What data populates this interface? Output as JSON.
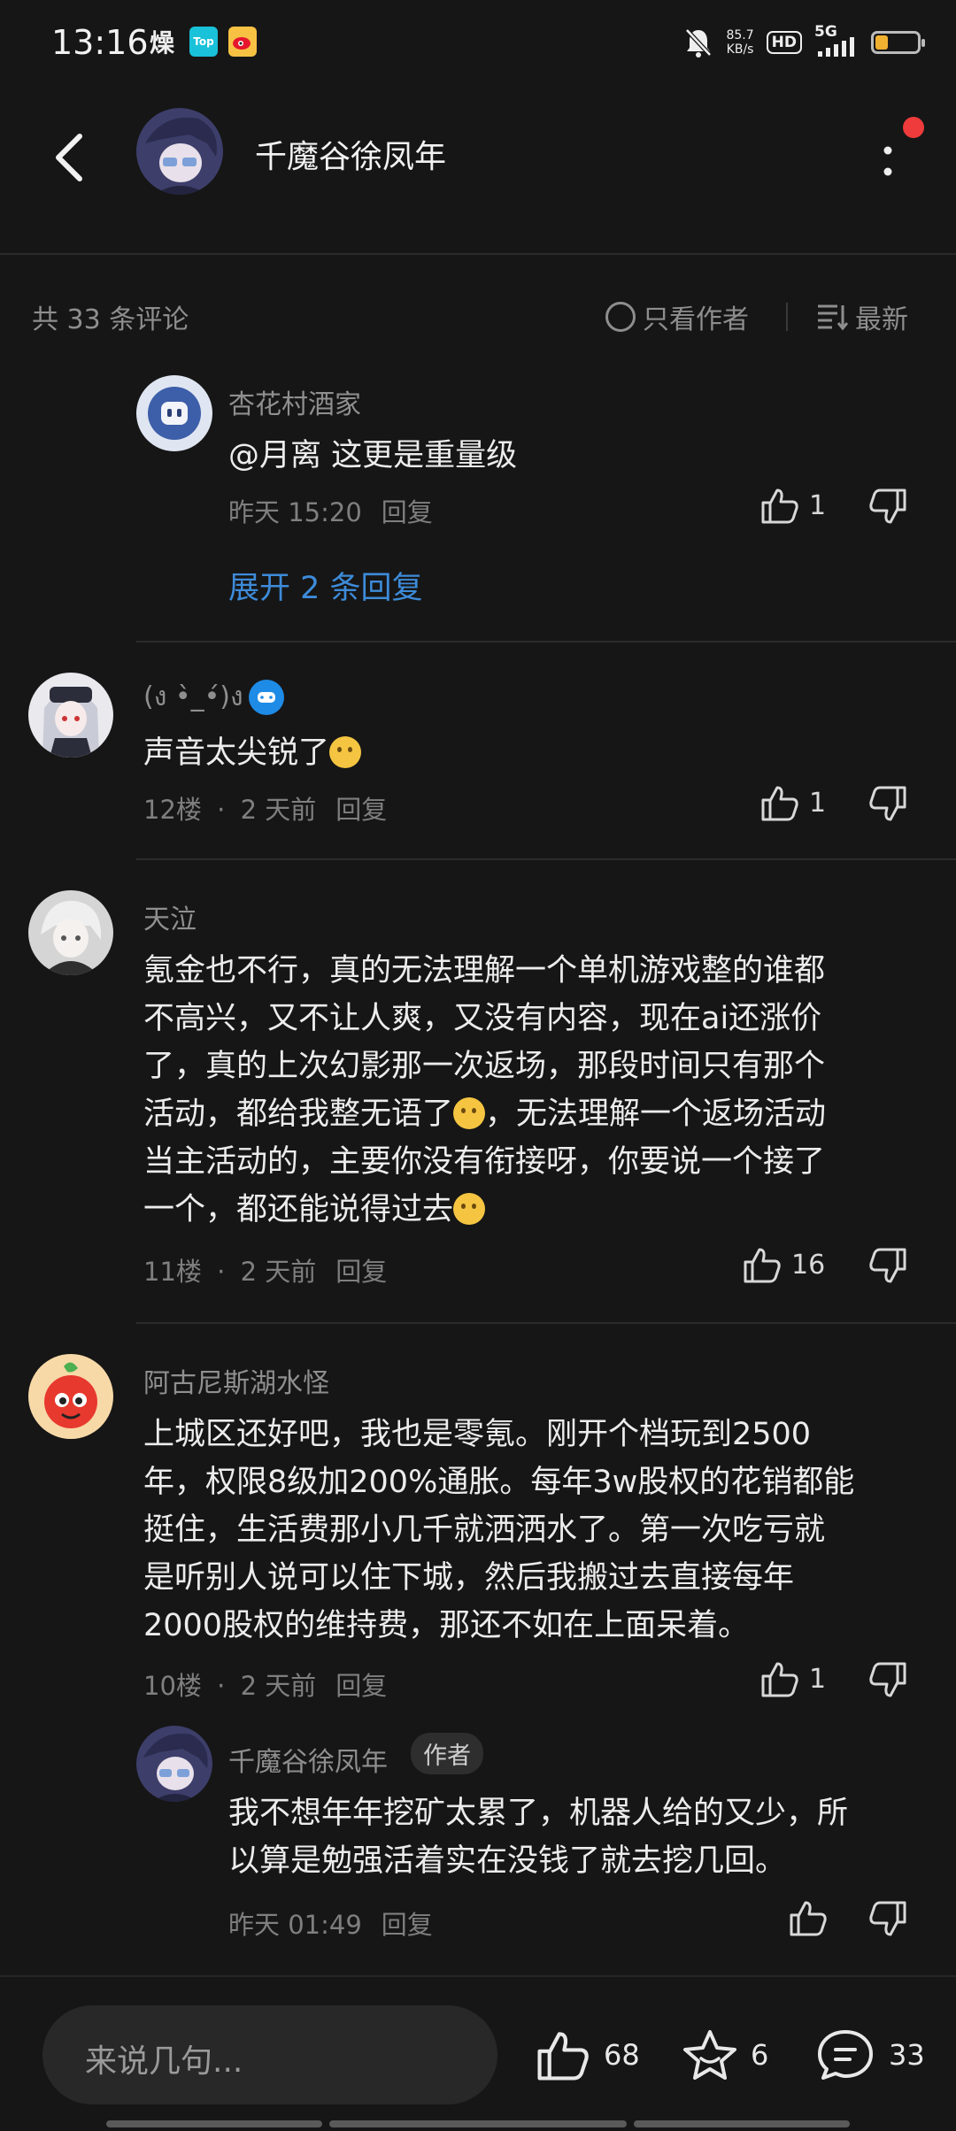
{
  "status_bar": {
    "time": "13:16",
    "net_speed_value": "85.7",
    "net_speed_unit": "KB/s",
    "hd_label": "HD",
    "signal_label": "5G",
    "battery_level": 0.3
  },
  "header": {
    "title": "千魔谷徐凤年"
  },
  "comment_bar": {
    "count_text": "共 33 条评论",
    "only_author": "只看作者",
    "sort": "最新"
  },
  "reply_top": {
    "username": "杏花村酒家",
    "text": "@月离  这更是重量级",
    "time": "昨天 15:20",
    "reply": "回复",
    "likes": "1",
    "expand": "展开 2 条回复"
  },
  "comment_12": {
    "username": "(ง •̀_•́)ง",
    "text": "声音太尖锐了",
    "floor": "12楼",
    "dot": "·",
    "time": "2 天前",
    "reply": "回复",
    "likes": "1"
  },
  "comment_11": {
    "username": "天泣",
    "lines": [
      "氪金也不行，真的无法理解一个单机游戏整的谁都",
      "不高兴，又不让人爽，又没有内容，现在ai还涨价",
      "了，真的上次幻影那一次返场，那段时间只有那个",
      "活动，都给我整无语了",
      "，无法理解一个返场活动",
      "当主活动的，主要你没有衔接呀，你要说一个接了",
      "一个，都还能说得过去"
    ],
    "floor": "11楼",
    "dot": "·",
    "time": "2 天前",
    "reply": "回复",
    "likes": "16"
  },
  "comment_10": {
    "username": "阿古尼斯湖水怪",
    "lines": [
      "上城区还好吧，我也是零氪。刚开个档玩到2500",
      "年，权限8级加200%通胀。每年3w股权的花销都能",
      "挺住，生活费那小几千就洒洒水了。第一次吃亏就",
      "是听别人说可以住下城，然后我搬过去直接每年",
      "2000股权的维持费，那还不如在上面呆着。"
    ],
    "floor": "10楼",
    "dot": "·",
    "time": "2 天前",
    "reply": "回复",
    "likes": "1"
  },
  "reply_author": {
    "username": "千魔谷徐凤年",
    "tag": "作者",
    "lines": [
      "我不想年年挖矿太累了，机器人给的又少，所",
      "以算是勉强活着实在没钱了就去挖几回。"
    ],
    "time": "昨天 01:49",
    "reply": "回复"
  },
  "bottom_bar": {
    "placeholder": "来说几句...",
    "likes": "68",
    "favorites": "6",
    "comments": "33"
  }
}
